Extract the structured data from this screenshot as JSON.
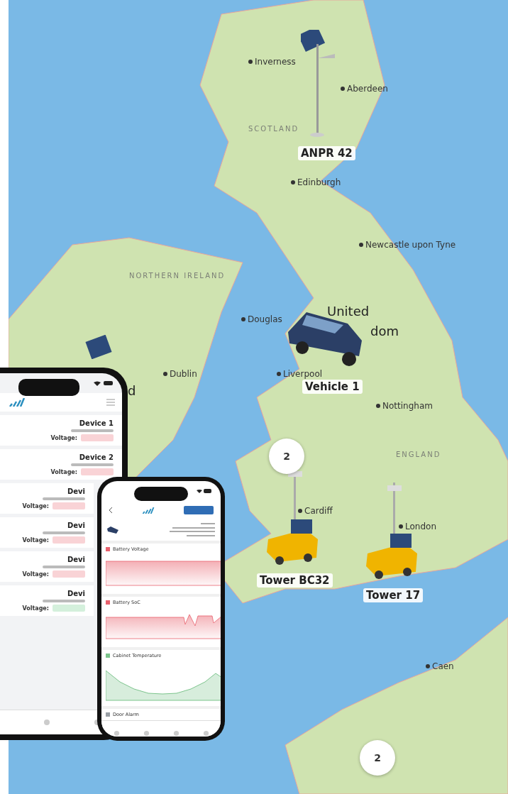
{
  "map": {
    "places": [
      {
        "name": "Inverness",
        "kind": "city"
      },
      {
        "name": "Aberdeen",
        "kind": "city"
      },
      {
        "name": "SCOTLAND",
        "kind": "region"
      },
      {
        "name": "Edinburgh",
        "kind": "city"
      },
      {
        "name": "Newcastle upon Tyne",
        "kind": "city"
      },
      {
        "name": "NORTHERN IRELAND",
        "kind": "region"
      },
      {
        "name": "Douglas",
        "kind": "city"
      },
      {
        "name": "United",
        "kind": "country"
      },
      {
        "name": "dom",
        "kind": "country"
      },
      {
        "name": "d",
        "kind": "country"
      },
      {
        "name": "Dublin",
        "kind": "city"
      },
      {
        "name": "Liverpool",
        "kind": "city"
      },
      {
        "name": "Nottingham",
        "kind": "city"
      },
      {
        "name": "ENGLAND",
        "kind": "region"
      },
      {
        "name": "Cardiff",
        "kind": "city"
      },
      {
        "name": "London",
        "kind": "city"
      },
      {
        "name": "Caen",
        "kind": "city"
      }
    ],
    "markers": [
      {
        "kind": "solar-pole",
        "label": "ANPR 42"
      },
      {
        "kind": "car",
        "label": "Vehicle 1"
      },
      {
        "kind": "tower",
        "label": "Tower BC32"
      },
      {
        "kind": "tower",
        "label": "Tower 17"
      },
      {
        "kind": "solar-panel"
      }
    ],
    "clusters": [
      {
        "count": "2"
      },
      {
        "count": "2"
      }
    ]
  },
  "device_list_phone": {
    "devices": [
      {
        "name": "Device 1",
        "voltage_label": "Voltage:",
        "color": "#f9d3d6"
      },
      {
        "name": "Device 2",
        "voltage_label": "Voltage:",
        "color": "#f9d3d6"
      },
      {
        "name": "Devi",
        "voltage_label": "Voltage:",
        "color": "#f9d3d6"
      },
      {
        "name": "Devi",
        "voltage_label": "Voltage:",
        "color": "#f9d3d6"
      },
      {
        "name": "Devi",
        "voltage_label": "Voltage:",
        "color": "#f9d3d6"
      },
      {
        "name": "Devi",
        "voltage_label": "Voltage:",
        "color": "#d4f0dc"
      }
    ]
  },
  "detail_phone": {
    "sections": [
      {
        "kind": "chart",
        "title": "Battery Voltage",
        "color": "#e8616d"
      },
      {
        "kind": "chart",
        "title": "Battery SoC",
        "color": "#e8616d"
      },
      {
        "kind": "line",
        "title": "Cabinet Temperature",
        "color": "#7cc48c"
      },
      {
        "kind": "row",
        "title": "Door Alarm",
        "color": "#9aa0a6"
      }
    ]
  }
}
